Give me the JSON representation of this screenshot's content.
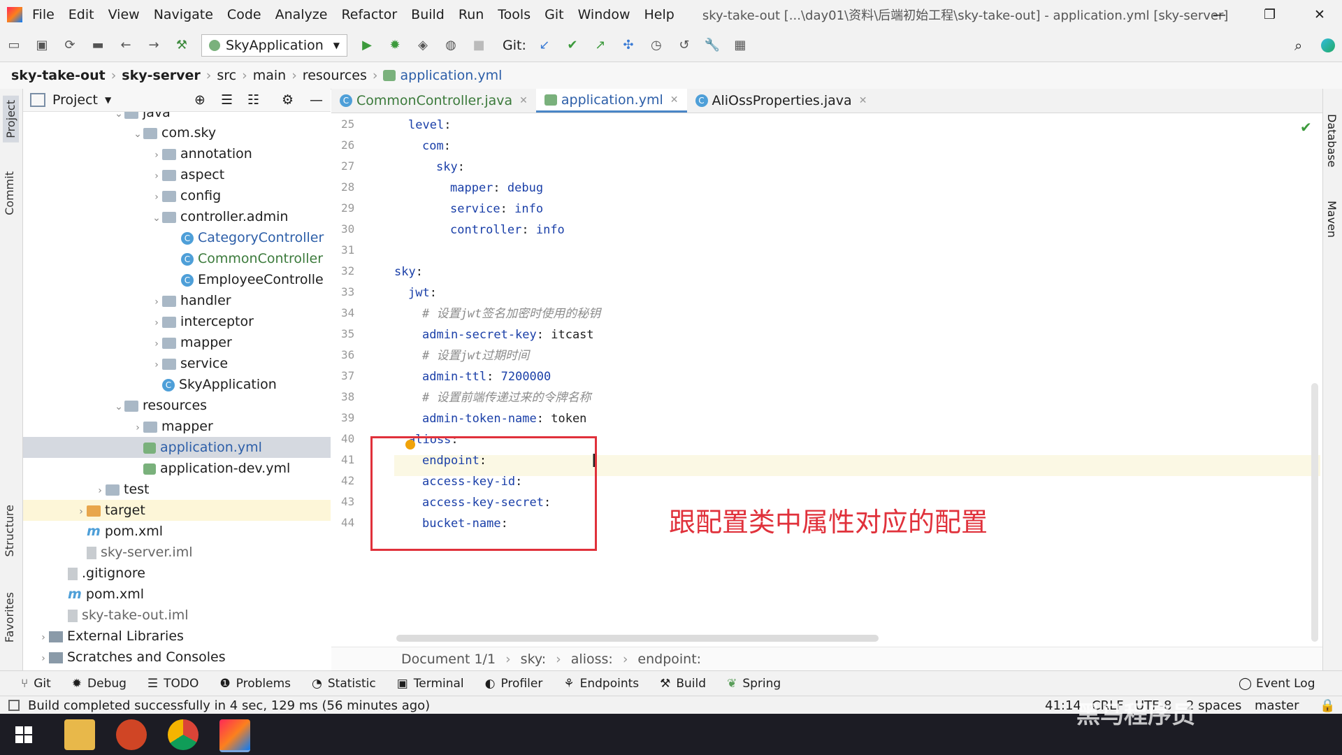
{
  "window": {
    "title": "sky-take-out [...\\day01\\资料\\后端初始工程\\sky-take-out] - application.yml [sky-server]",
    "menu": [
      "File",
      "Edit",
      "View",
      "Navigate",
      "Code",
      "Analyze",
      "Refactor",
      "Build",
      "Run",
      "Tools",
      "Git",
      "Window",
      "Help"
    ]
  },
  "toolbar": {
    "run_config": "SkyApplication",
    "git_label": "Git:"
  },
  "breadcrumb": [
    "sky-take-out",
    "sky-server",
    "src",
    "main",
    "resources",
    "application.yml"
  ],
  "left_stripe": [
    "Project",
    "Commit",
    "Structure",
    "Favorites"
  ],
  "right_stripe": [
    "Database",
    "Maven"
  ],
  "project_panel": {
    "title": "Project",
    "tree": [
      {
        "label": "java",
        "indent": 5,
        "kind": "folder",
        "arrow": "v"
      },
      {
        "label": "com.sky",
        "indent": 6,
        "kind": "folder",
        "arrow": "v"
      },
      {
        "label": "annotation",
        "indent": 7,
        "kind": "folder",
        "arrow": ">"
      },
      {
        "label": "aspect",
        "indent": 7,
        "kind": "folder",
        "arrow": ">"
      },
      {
        "label": "config",
        "indent": 7,
        "kind": "folder",
        "arrow": ">"
      },
      {
        "label": "controller.admin",
        "indent": 7,
        "kind": "folder",
        "arrow": "v"
      },
      {
        "label": "CategoryController",
        "indent": 8,
        "kind": "class",
        "color": "blue"
      },
      {
        "label": "CommonController",
        "indent": 8,
        "kind": "class",
        "color": "green"
      },
      {
        "label": "EmployeeControlle",
        "indent": 8,
        "kind": "class"
      },
      {
        "label": "handler",
        "indent": 7,
        "kind": "folder",
        "arrow": ">"
      },
      {
        "label": "interceptor",
        "indent": 7,
        "kind": "folder",
        "arrow": ">"
      },
      {
        "label": "mapper",
        "indent": 7,
        "kind": "folder",
        "arrow": ">"
      },
      {
        "label": "service",
        "indent": 7,
        "kind": "folder",
        "arrow": ">"
      },
      {
        "label": "SkyApplication",
        "indent": 7,
        "kind": "class"
      },
      {
        "label": "resources",
        "indent": 5,
        "kind": "folder",
        "arrow": "v"
      },
      {
        "label": "mapper",
        "indent": 6,
        "kind": "folder",
        "arrow": ">"
      },
      {
        "label": "application.yml",
        "indent": 6,
        "kind": "yml",
        "color": "blue",
        "selected": true
      },
      {
        "label": "application-dev.yml",
        "indent": 6,
        "kind": "yml"
      },
      {
        "label": "test",
        "indent": 4,
        "kind": "folder",
        "arrow": ">"
      },
      {
        "label": "target",
        "indent": 3,
        "kind": "folder-orange",
        "arrow": ">",
        "highlight": true
      },
      {
        "label": "pom.xml",
        "indent": 3,
        "kind": "maven"
      },
      {
        "label": "sky-server.iml",
        "indent": 3,
        "kind": "file",
        "color": "gray"
      },
      {
        "label": ".gitignore",
        "indent": 2,
        "kind": "file"
      },
      {
        "label": "pom.xml",
        "indent": 2,
        "kind": "maven"
      },
      {
        "label": "sky-take-out.iml",
        "indent": 2,
        "kind": "file",
        "color": "gray"
      },
      {
        "label": "External Libraries",
        "indent": 1,
        "kind": "lib",
        "arrow": ">"
      },
      {
        "label": "Scratches and Consoles",
        "indent": 1,
        "kind": "lib",
        "arrow": ">"
      }
    ]
  },
  "editor_tabs": [
    {
      "label": "CommonController.java",
      "active": false
    },
    {
      "label": "application.yml",
      "active": true
    },
    {
      "label": "AliOssProperties.java",
      "active": false
    }
  ],
  "code_lines": [
    {
      "n": "25",
      "indent": 1,
      "parts": [
        [
          "key",
          "level"
        ],
        [
          "txt",
          ":"
        ]
      ]
    },
    {
      "n": "26",
      "indent": 2,
      "parts": [
        [
          "key",
          "com"
        ],
        [
          "txt",
          ":"
        ]
      ]
    },
    {
      "n": "27",
      "indent": 3,
      "parts": [
        [
          "key",
          "sky"
        ],
        [
          "txt",
          ":"
        ]
      ]
    },
    {
      "n": "28",
      "indent": 4,
      "parts": [
        [
          "key",
          "mapper"
        ],
        [
          "txt",
          ": "
        ],
        [
          "val",
          "debug"
        ]
      ]
    },
    {
      "n": "29",
      "indent": 4,
      "parts": [
        [
          "key",
          "service"
        ],
        [
          "txt",
          ": "
        ],
        [
          "val",
          "info"
        ]
      ]
    },
    {
      "n": "30",
      "indent": 4,
      "parts": [
        [
          "key",
          "controller"
        ],
        [
          "txt",
          ": "
        ],
        [
          "val",
          "info"
        ]
      ]
    },
    {
      "n": "31",
      "indent": 0,
      "parts": []
    },
    {
      "n": "32",
      "indent": 0,
      "parts": [
        [
          "key",
          "sky"
        ],
        [
          "txt",
          ":"
        ]
      ]
    },
    {
      "n": "33",
      "indent": 1,
      "parts": [
        [
          "key",
          "jwt"
        ],
        [
          "txt",
          ":"
        ]
      ]
    },
    {
      "n": "34",
      "indent": 2,
      "parts": [
        [
          "cmt",
          "# 设置jwt签名加密时使用的秘钥"
        ]
      ]
    },
    {
      "n": "35",
      "indent": 2,
      "parts": [
        [
          "key",
          "admin-secret-key"
        ],
        [
          "txt",
          ": itcast"
        ]
      ]
    },
    {
      "n": "36",
      "indent": 2,
      "parts": [
        [
          "cmt",
          "# 设置jwt过期时间"
        ]
      ]
    },
    {
      "n": "37",
      "indent": 2,
      "parts": [
        [
          "key",
          "admin-ttl"
        ],
        [
          "txt",
          ": "
        ],
        [
          "val",
          "7200000"
        ]
      ]
    },
    {
      "n": "38",
      "indent": 2,
      "parts": [
        [
          "cmt",
          "# 设置前端传递过来的令牌名称"
        ]
      ]
    },
    {
      "n": "39",
      "indent": 2,
      "parts": [
        [
          "key",
          "admin-token-name"
        ],
        [
          "txt",
          ": token"
        ]
      ]
    },
    {
      "n": "40",
      "indent": 1,
      "parts": [
        [
          "key",
          "alioss"
        ],
        [
          "txt",
          ":"
        ]
      ]
    },
    {
      "n": "41",
      "indent": 2,
      "parts": [
        [
          "key",
          "endpoint"
        ],
        [
          "txt",
          ":"
        ]
      ]
    },
    {
      "n": "42",
      "indent": 2,
      "parts": [
        [
          "key",
          "access-key-id"
        ],
        [
          "txt",
          ":"
        ]
      ]
    },
    {
      "n": "43",
      "indent": 2,
      "parts": [
        [
          "key",
          "access-key-secret"
        ],
        [
          "txt",
          ":"
        ]
      ]
    },
    {
      "n": "44",
      "indent": 2,
      "parts": [
        [
          "key",
          "bucket-name"
        ],
        [
          "txt",
          ":"
        ]
      ]
    }
  ],
  "annotation": "跟配置类中属性对应的配置",
  "editor_breadcrumb": [
    "Document 1/1",
    "sky:",
    "alioss:",
    "endpoint:"
  ],
  "tool_windows": [
    "Git",
    "Debug",
    "TODO",
    "Problems",
    "Statistic",
    "Terminal",
    "Profiler",
    "Endpoints",
    "Build",
    "Spring"
  ],
  "event_log": "Event Log",
  "status": {
    "message": "Build completed successfully in 4 sec, 129 ms (56 minutes ago)",
    "position": "41:14",
    "line_sep": "CRLF",
    "encoding": "UTF-8",
    "indent": "2 spaces",
    "branch": "master"
  },
  "watermark": "黑马程序员",
  "colors": {
    "accent": "#4a86c7",
    "annotation": "#e0313b",
    "selection": "#d5d9e0",
    "key": "#1a3fa8"
  }
}
